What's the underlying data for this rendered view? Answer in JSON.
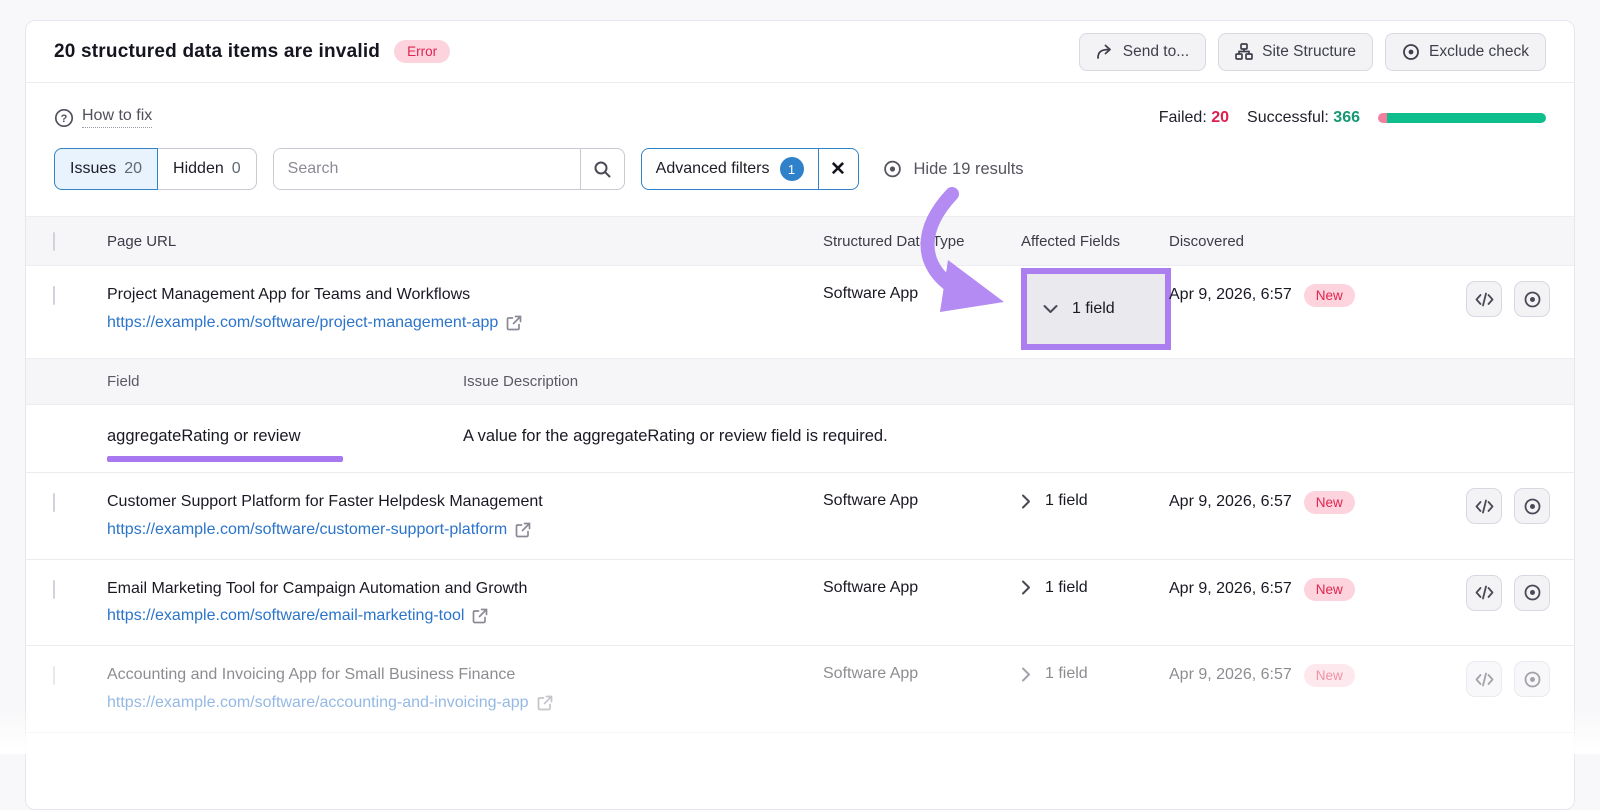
{
  "header": {
    "title": "20 structured data items are invalid",
    "error_badge": "Error",
    "send_to_label": "Send to...",
    "site_structure_label": "Site Structure",
    "exclude_check_label": "Exclude check"
  },
  "subheader": {
    "how_to_fix": "How to fix",
    "failed_label": "Failed:",
    "failed_value": "20",
    "successful_label": "Successful:",
    "successful_value": "366"
  },
  "filters": {
    "issues_label": "Issues",
    "issues_count": "20",
    "hidden_label": "Hidden",
    "hidden_count": "0",
    "search_placeholder": "Search",
    "advanced_filters_label": "Advanced filters",
    "advanced_filters_count": "1",
    "close_x": "✕",
    "hide_results_label": "Hide 19 results"
  },
  "table": {
    "columns": {
      "page_url": "Page URL",
      "type": "Structured Data Type",
      "affected": "Affected Fields",
      "discovered": "Discovered"
    },
    "rows": [
      {
        "title": "Project Management App for Teams and Workflows",
        "url": "https://example.com/software/project-management-app",
        "type": "Software App",
        "fields": "1 field",
        "date": "Apr 9, 2026, 6:57",
        "badge": "New"
      },
      {
        "title": "Customer Support Platform for Faster Helpdesk Management",
        "url": "https://example.com/software/customer-support-platform",
        "type": "Software App",
        "fields": "1 field",
        "date": "Apr 9, 2026, 6:57",
        "badge": "New"
      },
      {
        "title": "Email Marketing Tool for Campaign Automation and Growth",
        "url": "https://example.com/software/email-marketing-tool",
        "type": "Software App",
        "fields": "1 field",
        "date": "Apr 9, 2026, 6:57",
        "badge": "New"
      },
      {
        "title": "Accounting and Invoicing App for Small Business Finance",
        "url": "https://example.com/software/accounting-and-invoicing-app",
        "type": "Software App",
        "fields": "1 field",
        "date": "Apr 9, 2026, 6:57",
        "badge": "New"
      }
    ],
    "detail": {
      "field_header": "Field",
      "issue_header": "Issue Description",
      "field_value": "aggregateRating or review",
      "issue_value": "A value for the aggregateRating or review field is required."
    }
  },
  "icons": {
    "send_to": "curved-arrow-right",
    "site_structure": "org-chart",
    "exclude_check": "circle-dot-eye",
    "how_to_fix": "question-circle",
    "search": "magnifier",
    "hide_results": "eye",
    "expand_open": "chevron-down",
    "expand_closed": "chevron-right",
    "external_link": "arrow-out-of-box",
    "view_code": "code-brackets",
    "view_page": "eye"
  },
  "colors": {
    "accent_purple": "#ab7ff0",
    "error_red": "#e0244e",
    "error_bg": "#fdd3de",
    "success_green": "#169873",
    "bar_green": "#0ebe8d",
    "bar_pink": "#f27f9e",
    "link_blue": "#2b74ca",
    "selected_blue": "#3282c8"
  }
}
